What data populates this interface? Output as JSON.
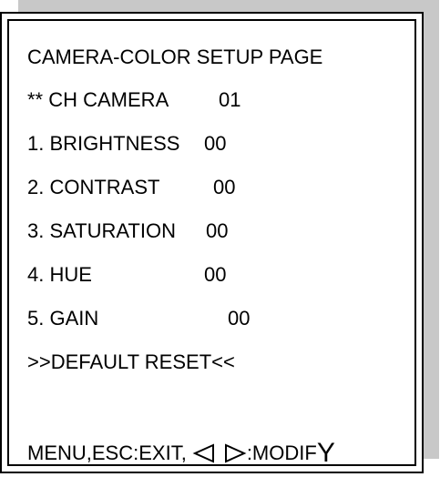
{
  "title": "CAMERA-COLOR SETUP PAGE",
  "channel": {
    "label": "** CH CAMERA",
    "value": "01"
  },
  "items": [
    {
      "label": "1. BRIGHTNESS",
      "value": "00"
    },
    {
      "label": "2. CONTRAST",
      "value": "00"
    },
    {
      "label": "3. SATURATION",
      "value": "00"
    },
    {
      "label": "4. HUE",
      "value": "00"
    },
    {
      "label": "5. GAIN",
      "value": "00"
    }
  ],
  "reset_label": ">>DEFAULT RESET<<",
  "footer": {
    "prefix": "MENU,ESC:EXIT,",
    "suffix": ":MODIF",
    "last_char": "Y",
    "left_icon": "left-triangle-icon",
    "right_icon": "right-triangle-icon"
  }
}
